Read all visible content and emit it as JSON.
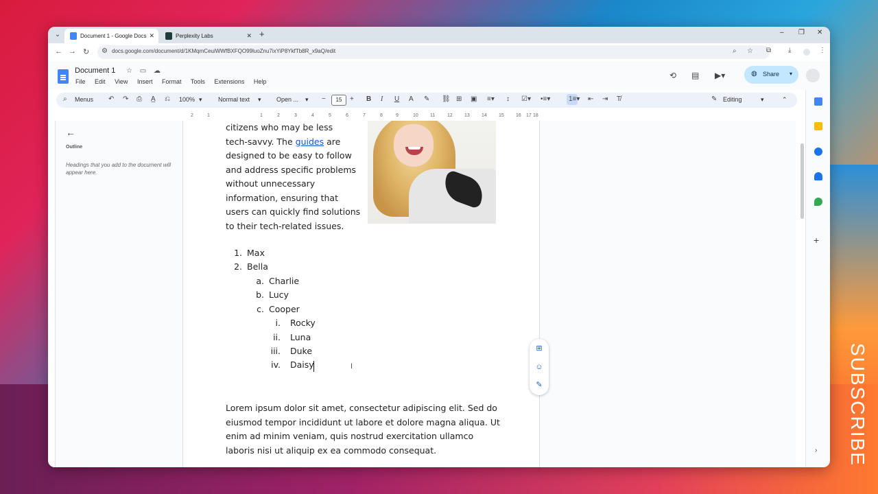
{
  "browser": {
    "tabs": [
      {
        "label": "Document 1 - Google Docs",
        "active": true,
        "icon": "google-docs-icon"
      },
      {
        "label": "Perplexity Labs",
        "active": false,
        "icon": "perplexity-icon"
      }
    ],
    "url": "docs.google.com/document/d/1KMqmCeuiWWfBXFQO99luoZnu7ixYiP8YkfTb8R_x9aQ/edit"
  },
  "docs": {
    "title": "Document 1",
    "menu": [
      "File",
      "Edit",
      "View",
      "Insert",
      "Format",
      "Tools",
      "Extensions",
      "Help"
    ],
    "share_label": "Share"
  },
  "toolbar": {
    "menus_label": "Menus",
    "zoom": "100%",
    "style": "Normal text",
    "font": "Open ...",
    "font_size": "15",
    "mode": "Editing"
  },
  "ruler": [
    "2",
    "1",
    "1",
    "2",
    "3",
    "4",
    "5",
    "6",
    "7",
    "8",
    "9",
    "10",
    "11",
    "12",
    "13",
    "14",
    "15",
    "16",
    "17",
    "18"
  ],
  "outline": {
    "title": "Outline",
    "hint": "Headings that you add to the document will appear here."
  },
  "document": {
    "para1_lines": [
      "citizens who may be less",
      "tech-savvy. The ",
      "guides",
      " are",
      "designed to  be easy to follow",
      "and address specific problems",
      "without  unnecessary",
      "information, ensuring that",
      "users can quickly find solutions",
      "to their tech-related issues."
    ],
    "list": [
      {
        "marker": "1.",
        "text": "Max"
      },
      {
        "marker": "2.",
        "text": "Bella"
      },
      {
        "marker": "a.",
        "text": "Charlie"
      },
      {
        "marker": "b.",
        "text": "Lucy"
      },
      {
        "marker": "c.",
        "text": "Cooper"
      },
      {
        "marker": "i.",
        "text": "Rocky"
      },
      {
        "marker": "ii.",
        "text": "Luna"
      },
      {
        "marker": "iii.",
        "text": "Duke"
      },
      {
        "marker": "iv.",
        "text": "Daisy"
      }
    ],
    "lorem_lines": [
      "Lorem ipsum dolor sit amet, consectetur adipiscing elit. Sed do",
      "eiusmod tempor incididunt ut labore et dolore magna aliqua. Ut",
      "enim ad minim veniam, quis nostrud exercitation ullamco",
      "laboris nisi ut aliquip ex ea commodo consequat."
    ]
  },
  "overlay": {
    "subscribe": "SUBSCRIBE"
  },
  "colors": {
    "docs_blue": "#4285f4",
    "share_bg": "#c2e7ff",
    "link": "#1155cc"
  }
}
